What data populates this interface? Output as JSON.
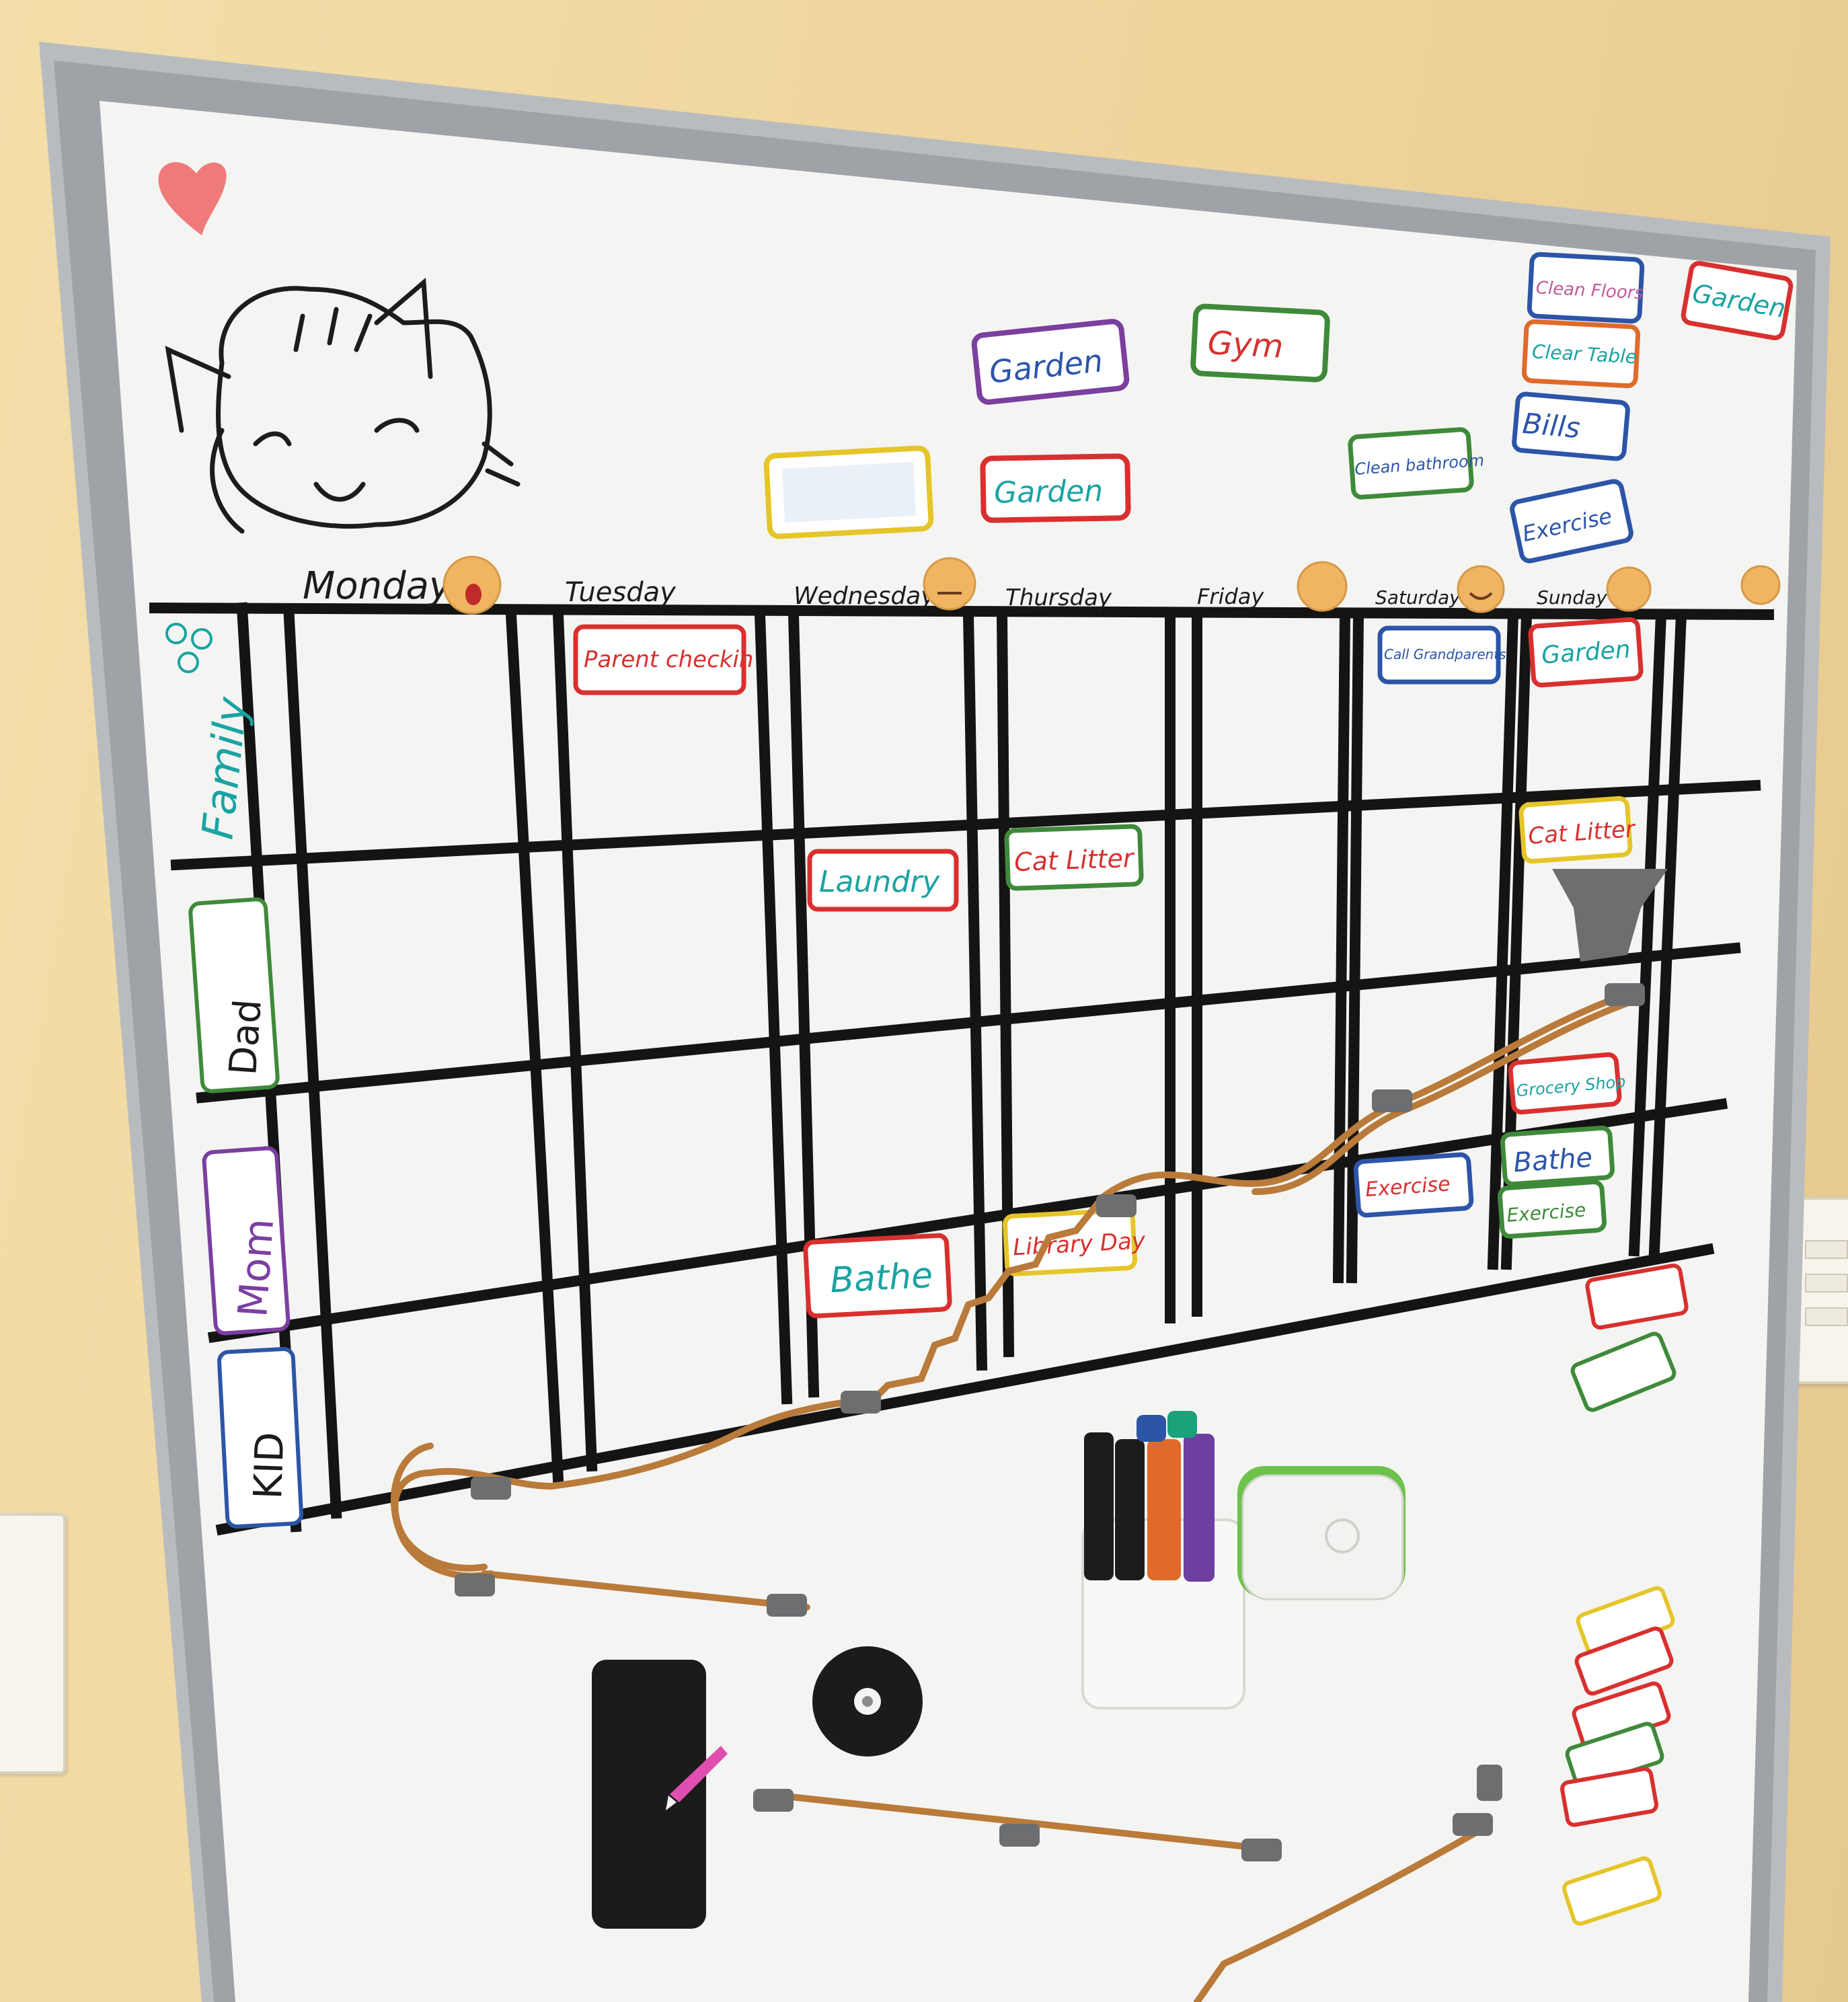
{
  "board": {
    "days": [
      "Monday",
      "Tuesday",
      "Wednesday",
      "Thursday",
      "Friday",
      "Saturday",
      "Sunday"
    ],
    "rows": [
      "Family",
      "Dad",
      "Mom",
      "KID"
    ]
  },
  "spare_tags": {
    "garden_1": "Garden",
    "garden_2": "Garden",
    "gym": "Gym",
    "clean_floors": "Clean Floors",
    "clear_table": "Clear Table",
    "bills": "Bills",
    "exercise": "Exercise",
    "clean_bathroom": "Clean bathroom",
    "garden_corner": "Garden"
  },
  "scheduled_tags": {
    "tuesday_family": "Parent checkin",
    "saturday_family": "Call Grandparents",
    "sunday_family": "Garden",
    "wednesday_dad": "Laundry",
    "thursday_dad": "Cat Litter",
    "sunday_dad": "Cat Litter",
    "sunday_dad_2": "Grocery Shop",
    "saturday_mom": "Exercise",
    "sunday_mom_1": "Bathe",
    "sunday_mom_2": "Exercise",
    "wednesday_kid": "Bathe",
    "thursday_kid": "Library Day"
  },
  "colors": {
    "wall": "#efd49c",
    "board": "#f4f5f2",
    "frame": "#b9bcbf",
    "grid": "#141414",
    "track": "#b97a3a",
    "tag_red": "#d8302f",
    "tag_green": "#3f8a3a",
    "tag_purple": "#7b3fa0",
    "tag_blue": "#2c55a8",
    "tag_orange": "#e06a2a",
    "tag_yellow": "#e5c52a",
    "teal_marker": "#1aa3a3"
  },
  "icons": [
    "heart-icon",
    "cat-drawing-icon",
    "emoji-magnet-icon",
    "marker-icon",
    "eraser-icon",
    "gear-icon",
    "light-switch-icon"
  ]
}
